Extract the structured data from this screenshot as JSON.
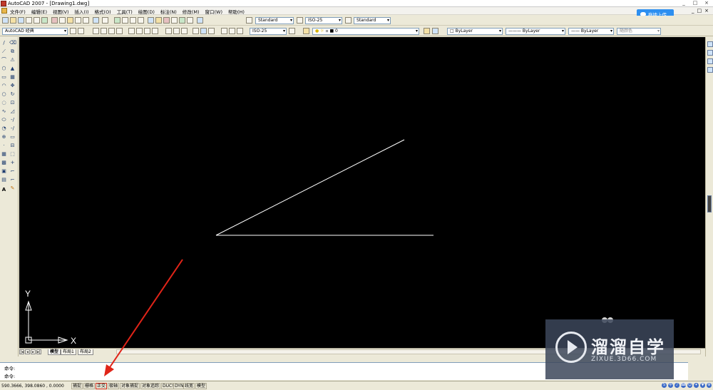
{
  "window": {
    "title": "AutoCAD 2007 - [Drawing1.dwg]",
    "controls": [
      "_",
      "□",
      "×"
    ]
  },
  "menubar": {
    "items": [
      "文件(F)",
      "编辑(E)",
      "视图(V)",
      "插入(I)",
      "格式(O)",
      "工具(T)",
      "绘图(D)",
      "标注(N)",
      "修改(M)",
      "窗口(W)",
      "帮助(H)"
    ],
    "right_controls": [
      "_",
      "□",
      "×"
    ]
  },
  "upload_button": {
    "label": "拖拽上传"
  },
  "toolbar1": {
    "text_style": "Standard",
    "dim_style": "ISO-25",
    "table_style": "Standard"
  },
  "toolbar2": {
    "workspace": "AutoCAD 经典",
    "dim_style": "ISO-25",
    "layer": "0",
    "color": "ByLayer",
    "linetype": "ByLayer",
    "lineweight": "ByLayer",
    "plot_style": "随颜色"
  },
  "left_tools": [
    "/",
    "⟋",
    "⌒",
    "⬡",
    "▭",
    "◠",
    "○",
    "◌",
    "∿",
    "⬭",
    "◔",
    "⊕",
    "·",
    "▦",
    "▩",
    "▣",
    "▤",
    "A"
  ],
  "left_tools2": [
    "⌫",
    "⧉",
    "⚠",
    "▲",
    "▦",
    "✥",
    "↻",
    "⊡",
    "◿",
    "-/",
    "-/",
    "▭",
    "⊟",
    "⬚",
    "+",
    "⌐",
    "⌐",
    "✎"
  ],
  "ucs": {
    "x_label": "X",
    "y_label": "Y"
  },
  "layout_tabs": {
    "tabs": [
      "模型",
      "布局1",
      "布局2"
    ],
    "active": "模型"
  },
  "command": {
    "line1": "命令:",
    "line2": "命令:"
  },
  "status": {
    "coords": "590.3666,  398.0860 , 0.0000",
    "buttons": [
      {
        "label": "捕捉",
        "on": false
      },
      {
        "label": "栅格",
        "on": false
      },
      {
        "label": "正交",
        "on": true
      },
      {
        "label": "极轴",
        "on": false
      },
      {
        "label": "对象捕捉",
        "on": false
      },
      {
        "label": "对象追踪",
        "on": false
      },
      {
        "label": "DUCS",
        "on": false
      },
      {
        "label": "DYN",
        "on": false
      },
      {
        "label": "线宽",
        "on": false
      },
      {
        "label": "模型",
        "on": false
      }
    ],
    "tray": [
      "S",
      "中",
      "♪",
      "⌨",
      "☺",
      "✦",
      "▼",
      "⚙"
    ]
  },
  "watermark": {
    "title": "溜溜自学",
    "url": "ZIXUE.3D66.COM"
  },
  "colors": {
    "canvas": "#000000",
    "line": "#ffffff",
    "arrow": "#e02418",
    "watermark_bg": "#3c465a"
  }
}
